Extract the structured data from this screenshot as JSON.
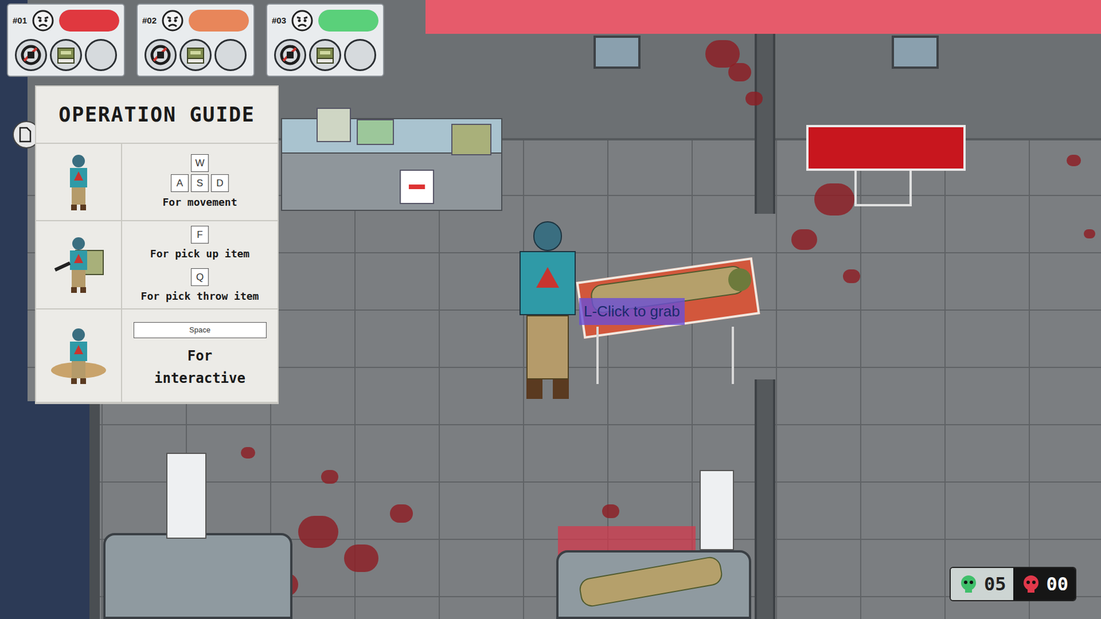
{
  "patients": [
    {
      "label": "#01",
      "health": {
        "level": 1,
        "color": "#e0383f"
      },
      "slots": [
        {
          "kind": "tool"
        },
        {
          "kind": "kit"
        },
        {
          "kind": "empty"
        }
      ]
    },
    {
      "label": "#02",
      "health": {
        "level": 1,
        "color": "#e8865a"
      },
      "slots": [
        {
          "kind": "tool"
        },
        {
          "kind": "kit"
        },
        {
          "kind": "empty"
        }
      ]
    },
    {
      "label": "#03",
      "health": {
        "level": 1,
        "color": "#5ad07a"
      },
      "slots": [
        {
          "kind": "tool"
        },
        {
          "kind": "kit"
        },
        {
          "kind": "empty"
        }
      ]
    }
  ],
  "guide": {
    "title": "OPERATION GUIDE",
    "rows": [
      {
        "sections": [
          {
            "keys": [
              [
                {
                  "label": "W",
                  "kind": "key"
                }
              ],
              [
                {
                  "label": "A",
                  "kind": "key"
                },
                {
                  "label": "S",
                  "kind": "key"
                },
                {
                  "label": "D",
                  "kind": "key"
                }
              ]
            ],
            "caption": "For movement"
          }
        ]
      },
      {
        "sections": [
          {
            "keys": [
              [
                {
                  "label": "F",
                  "kind": "key"
                }
              ]
            ],
            "caption": "For pick up item"
          },
          {
            "keys": [
              [
                {
                  "label": "Q",
                  "kind": "key"
                }
              ]
            ],
            "caption": "For pick throw item"
          }
        ]
      },
      {
        "sections": [
          {
            "keys": [
              [
                {
                  "label": "Space",
                  "kind": "bar"
                }
              ]
            ],
            "caption": "For interactive"
          }
        ]
      }
    ]
  },
  "prompt": {
    "text": "L-Click to grab"
  },
  "counters": [
    {
      "value": "05",
      "color": "#3fbf6a"
    },
    {
      "value": "00",
      "color": "#e0384a"
    }
  ]
}
